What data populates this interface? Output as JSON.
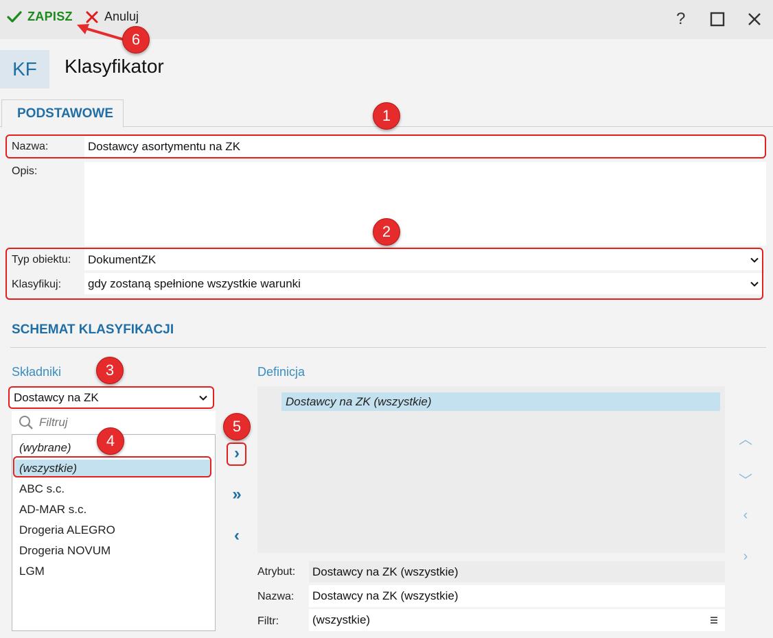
{
  "toolbar": {
    "save_label": "ZAPISZ",
    "cancel_label": "Anuluj",
    "help_label": "?"
  },
  "header": {
    "tile": "KF",
    "title": "Klasyfikator"
  },
  "tabs": [
    {
      "label": "PODSTAWOWE",
      "active": true
    }
  ],
  "form": {
    "name_label": "Nazwa:",
    "name_value": "Dostawcy asortymentu na ZK",
    "desc_label": "Opis:",
    "desc_value": "",
    "type_label": "Typ obiektu:",
    "type_value": "DokumentZK",
    "classify_label": "Klasyfikuj:",
    "classify_value": "gdy zostaną spełnione wszystkie warunki"
  },
  "schema": {
    "title": "SCHEMAT KLASYFIKACJI",
    "components_label": "Składniki",
    "components_select": "Dostawcy na ZK",
    "filter_placeholder": "Filtruj",
    "items": [
      "(wybrane)",
      "(wszystkie)",
      "ABC s.c.",
      "AD-MAR s.c.",
      "Drogeria ALEGRO",
      "Drogeria NOVUM",
      "LGM"
    ],
    "definition_label": "Definicja",
    "definition_items": [
      "Dostawcy na ZK (wszystkie)"
    ],
    "attr_label": "Atrybut:",
    "attr_value": "Dostawcy na ZK (wszystkie)",
    "dname_label": "Nazwa:",
    "dname_value": "Dostawcy na ZK (wszystkie)",
    "filter_label": "Filtr:",
    "filter_value": "(wszystkie)"
  },
  "annotations": [
    "1",
    "2",
    "3",
    "4",
    "5",
    "6"
  ],
  "colors": {
    "accent": "#1f6fa6",
    "save_green": "#1c8a1c",
    "annotation_red": "#e52b2b",
    "selection": "#c3e1ef"
  },
  "icons": [
    "check-icon",
    "close-x-icon",
    "help-icon",
    "maximize-icon",
    "window-close-icon",
    "chevron-down-icon",
    "search-icon",
    "menu-icon"
  ]
}
